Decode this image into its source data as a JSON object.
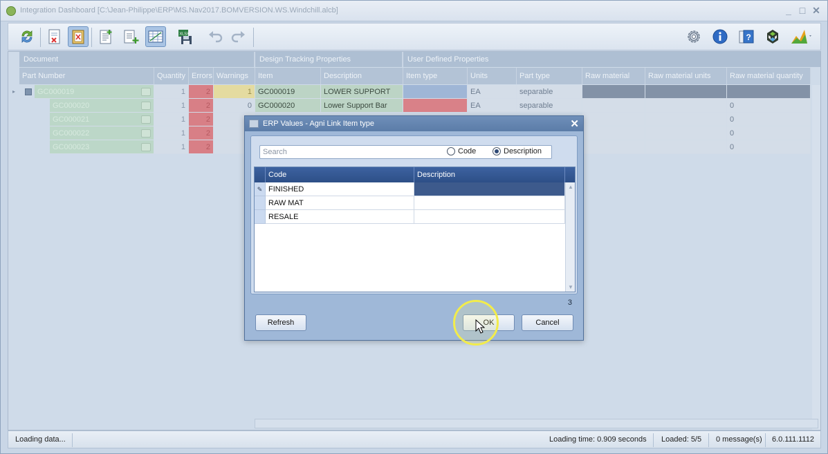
{
  "window": {
    "title": "Integration Dashboard [C:\\Jean-Philippe\\ERP\\MS.Nav2017.BOMVERSION.WS.Windchill.alcb]",
    "minimize": "_",
    "maximize": "□",
    "close": "✕"
  },
  "toolbar": {
    "left_icons": [
      "refresh-icon",
      "remove-document-icon",
      "clipboard-icon",
      "new-document-icon",
      "add-document-icon",
      "grid-view-icon",
      "save-xlsx-icon",
      "undo-icon",
      "redo-icon"
    ],
    "right_icons": [
      "settings-gear-icon",
      "info-icon",
      "help-icon",
      "recycle-logo-icon",
      "chart-icon"
    ],
    "xlsx_label": "XLSX"
  },
  "grid": {
    "bands": {
      "document": "Document",
      "design": "Design Tracking Properties",
      "user": "User Defined Properties"
    },
    "columns": {
      "part_number": "Part Number",
      "quantity": "Quantity",
      "errors": "Errors",
      "warnings": "Warnings",
      "item": "Item",
      "description": "Description",
      "item_type": "Item type",
      "units": "Units",
      "part_type": "Part type",
      "raw_material": "Raw material",
      "raw_material_units": "Raw material units",
      "raw_material_quantity": "Raw material quantity"
    },
    "rows": [
      {
        "part": "GC000019",
        "qty": "1",
        "errors": "2",
        "warnings": "1",
        "item": "GC000019",
        "desc": "LOWER SUPPORT",
        "units": "EA",
        "part_type": "separable",
        "rmq": ""
      },
      {
        "part": "GC000020",
        "qty": "1",
        "errors": "2",
        "warnings": "0",
        "item": "GC000020",
        "desc": "Lower Support Bar",
        "units": "EA",
        "part_type": "separable",
        "rmq": "0"
      },
      {
        "part": "GC000021",
        "qty": "1",
        "errors": "2",
        "warnings": "",
        "item": "",
        "desc": "",
        "units": "",
        "part_type": "",
        "rmq": "0"
      },
      {
        "part": "GC000022",
        "qty": "1",
        "errors": "2",
        "warnings": "",
        "item": "",
        "desc": "",
        "units": "",
        "part_type": "",
        "rmq": "0"
      },
      {
        "part": "GC000023",
        "qty": "1",
        "errors": "2",
        "warnings": "",
        "item": "",
        "desc": "",
        "units": "",
        "part_type": "",
        "rmq": "0"
      }
    ]
  },
  "status": {
    "left": "Loading data...",
    "loading_time": "Loading time: 0.909 seconds",
    "loaded": "Loaded: 5/5",
    "messages": "0 message(s)",
    "version": "6.0.111.1112"
  },
  "dialog": {
    "title": "ERP Values - Agni Link Item type",
    "close": "✕",
    "search_placeholder": "Search",
    "search_value": "",
    "radio_code": "Code",
    "radio_description": "Description",
    "selected_radio": "Description",
    "columns": {
      "code": "Code",
      "description": "Description"
    },
    "rows": [
      {
        "code": "FINISHED",
        "description": ""
      },
      {
        "code": "RAW MAT",
        "description": ""
      },
      {
        "code": "RESALE",
        "description": ""
      }
    ],
    "count": "3",
    "refresh_label": "Refresh",
    "ok_label": "OK",
    "cancel_label": "Cancel"
  }
}
